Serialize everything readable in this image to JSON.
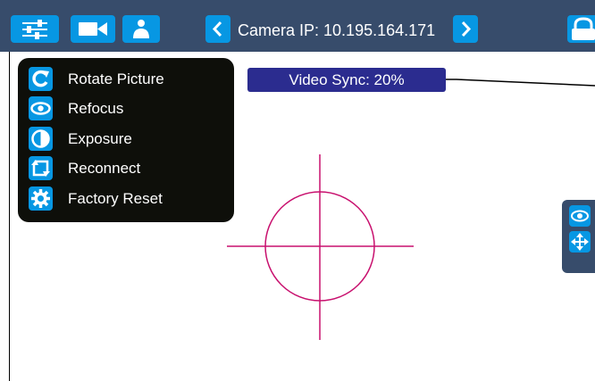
{
  "topbar": {
    "camera_label": "Camera IP: 10.195.164.171",
    "icons": {
      "settings": "sliders-icon",
      "video": "video-camera-icon",
      "user": "user-icon",
      "prev": "chevron-left-icon",
      "next": "chevron-right-icon",
      "lock": "lock-icon"
    },
    "background": "#374c6b",
    "accent": "#0797e3"
  },
  "menu": {
    "items": [
      {
        "label": "Rotate Picture",
        "icon": "rotate-icon"
      },
      {
        "label": "Refocus",
        "icon": "eye-icon"
      },
      {
        "label": "Exposure",
        "icon": "half-circle-icon"
      },
      {
        "label": "Reconnect",
        "icon": "reconnect-icon"
      },
      {
        "label": "Factory Reset",
        "icon": "gear-icon"
      }
    ],
    "background": "#0e0f0a"
  },
  "video_sync": {
    "label": "Video Sync: 20%",
    "background": "#2b2c8f"
  },
  "crosshair": {
    "color": "#c8106e"
  },
  "side_panel": {
    "icons": [
      "eye-icon",
      "move-arrows-icon"
    ]
  }
}
